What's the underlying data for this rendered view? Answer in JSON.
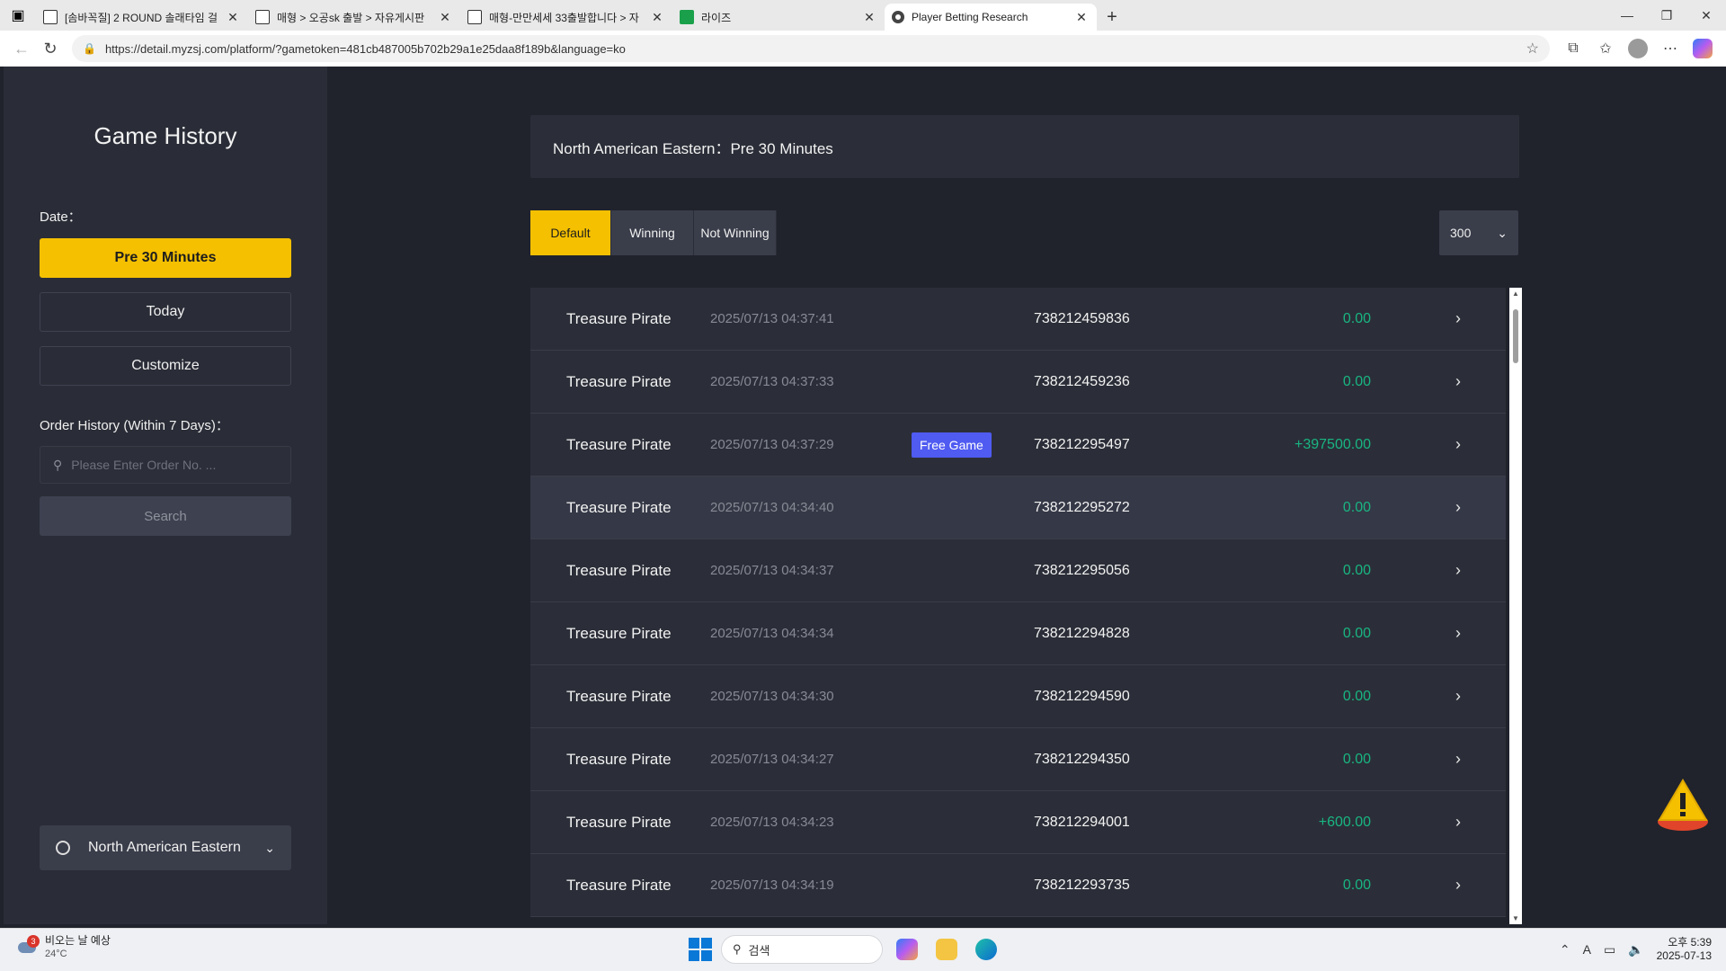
{
  "browser": {
    "tabs": [
      {
        "title": "[솜바꼭질] 2 ROUND 솔래타임 걸",
        "active": false
      },
      {
        "title": "매형 > 오공sk 출발 > 자유게시판",
        "active": false
      },
      {
        "title": "매형-만만세세 33출발합니다 > 자",
        "active": false
      },
      {
        "title": "라이즈",
        "active": false
      },
      {
        "title": "Player Betting Research",
        "active": true
      }
    ],
    "url": "https://detail.myzsj.com/platform/?gametoken=481cb487005b702b29a1e25daa8f189b&language=ko"
  },
  "sidebar": {
    "title": "Game History",
    "date_label": "Date：",
    "date_options": [
      "Pre 30 Minutes",
      "Today",
      "Customize"
    ],
    "selected_date": "Pre 30 Minutes",
    "order_history_label": "Order History (Within 7 Days)：",
    "order_placeholder": "Please Enter Order No. ...",
    "search_label": "Search",
    "timezone": "North American Eastern"
  },
  "main": {
    "header": "North American Eastern：Pre 30 Minutes",
    "filters": [
      "Default",
      "Winning",
      "Not Winning"
    ],
    "active_filter": "Default",
    "page_size": "300",
    "rows": [
      {
        "game": "Treasure Pirate",
        "time": "2025/07/13 04:37:41",
        "badge": "",
        "order": "738212459836",
        "amount": "0.00"
      },
      {
        "game": "Treasure Pirate",
        "time": "2025/07/13 04:37:33",
        "badge": "",
        "order": "738212459236",
        "amount": "0.00"
      },
      {
        "game": "Treasure Pirate",
        "time": "2025/07/13 04:37:29",
        "badge": "Free Game",
        "order": "738212295497",
        "amount": "+397500.00"
      },
      {
        "game": "Treasure Pirate",
        "time": "2025/07/13 04:34:40",
        "badge": "",
        "order": "738212295272",
        "amount": "0.00"
      },
      {
        "game": "Treasure Pirate",
        "time": "2025/07/13 04:34:37",
        "badge": "",
        "order": "738212295056",
        "amount": "0.00"
      },
      {
        "game": "Treasure Pirate",
        "time": "2025/07/13 04:34:34",
        "badge": "",
        "order": "738212294828",
        "amount": "0.00"
      },
      {
        "game": "Treasure Pirate",
        "time": "2025/07/13 04:34:30",
        "badge": "",
        "order": "738212294590",
        "amount": "0.00"
      },
      {
        "game": "Treasure Pirate",
        "time": "2025/07/13 04:34:27",
        "badge": "",
        "order": "738212294350",
        "amount": "0.00"
      },
      {
        "game": "Treasure Pirate",
        "time": "2025/07/13 04:34:23",
        "badge": "",
        "order": "738212294001",
        "amount": "+600.00"
      },
      {
        "game": "Treasure Pirate",
        "time": "2025/07/13 04:34:19",
        "badge": "",
        "order": "738212293735",
        "amount": "0.00"
      }
    ]
  },
  "taskbar": {
    "weather_title": "비오는 날 예상",
    "weather_temp": "24°C",
    "weather_badge": "3",
    "search_placeholder": "검색",
    "time": "오후 5:39",
    "date": "2025-07-13"
  },
  "colors": {
    "accent": "#f5c000",
    "win": "#19b582",
    "badge": "#4f5bf1",
    "page_bg": "#20232c",
    "panel_bg": "#2b2e38"
  }
}
